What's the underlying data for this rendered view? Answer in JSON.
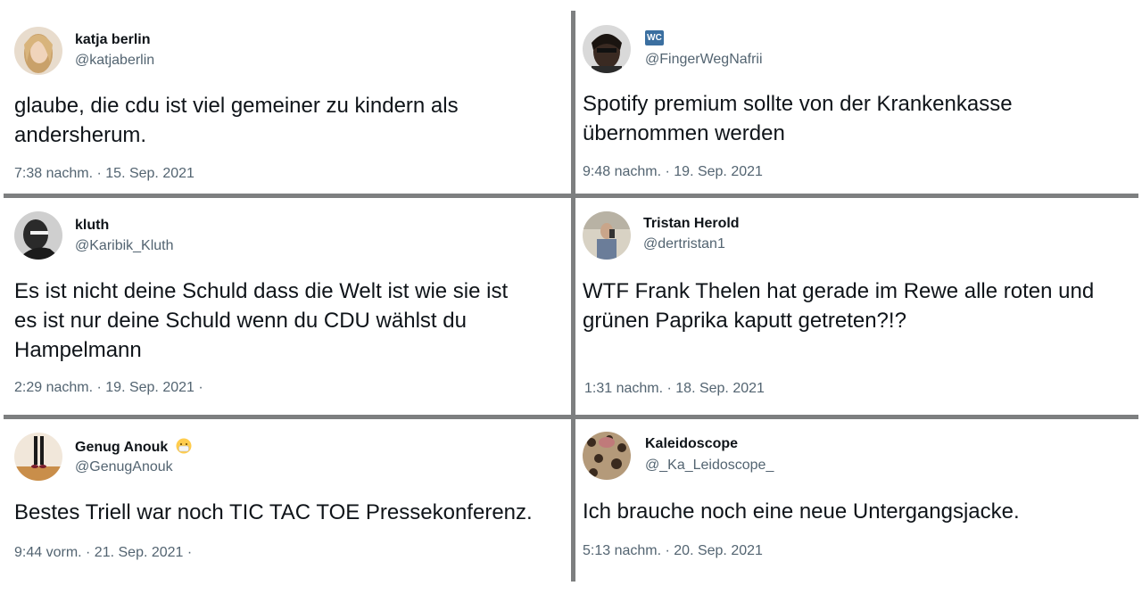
{
  "tweets": [
    {
      "name": "katja berlin",
      "handle": "@katjaberlin",
      "text": "glaube, die cdu ist viel gemeiner zu kindern als\nandersherum.",
      "meta": "7:38 nachm. · 15. Sep. 2021"
    },
    {
      "name": "",
      "badge": "WC",
      "handle": "@FingerWegNafrii",
      "text": "Spotify premium sollte von der Krankenkasse\nübernommen werden",
      "meta": "9:48 nachm. · 19. Sep. 2021"
    },
    {
      "name": "kluth",
      "handle": "@Karibik_Kluth",
      "text": "Es ist nicht deine Schuld dass die Welt ist wie sie ist\nes ist nur deine Schuld wenn du CDU wählst du\nHampelmann",
      "meta": "2:29 nachm. · 19. Sep. 2021 ·"
    },
    {
      "name": "Tristan Herold",
      "handle": "@dertristan1",
      "text": "WTF Frank Thelen hat gerade im Rewe alle roten und\ngrünen Paprika kaputt getreten?!?",
      "meta": "1:31 nachm. · 18. Sep. 2021"
    },
    {
      "name": "Genug Anouk",
      "handle": "@GenugAnouk",
      "text": "Bestes Triell war noch TIC TAC TOE Pressekonferenz.",
      "meta": "9:44 vorm. · 21. Sep. 2021 ·"
    },
    {
      "name": "Kaleidoscope",
      "handle": "@_Ka_Leidoscope_",
      "text": "Ich brauche noch eine neue Untergangsjacke.",
      "meta": "5:13 nachm. · 20. Sep. 2021"
    }
  ],
  "icons": {
    "mask_emoji": "face-with-medical-mask-icon",
    "divider_color": "#7d7f80"
  }
}
